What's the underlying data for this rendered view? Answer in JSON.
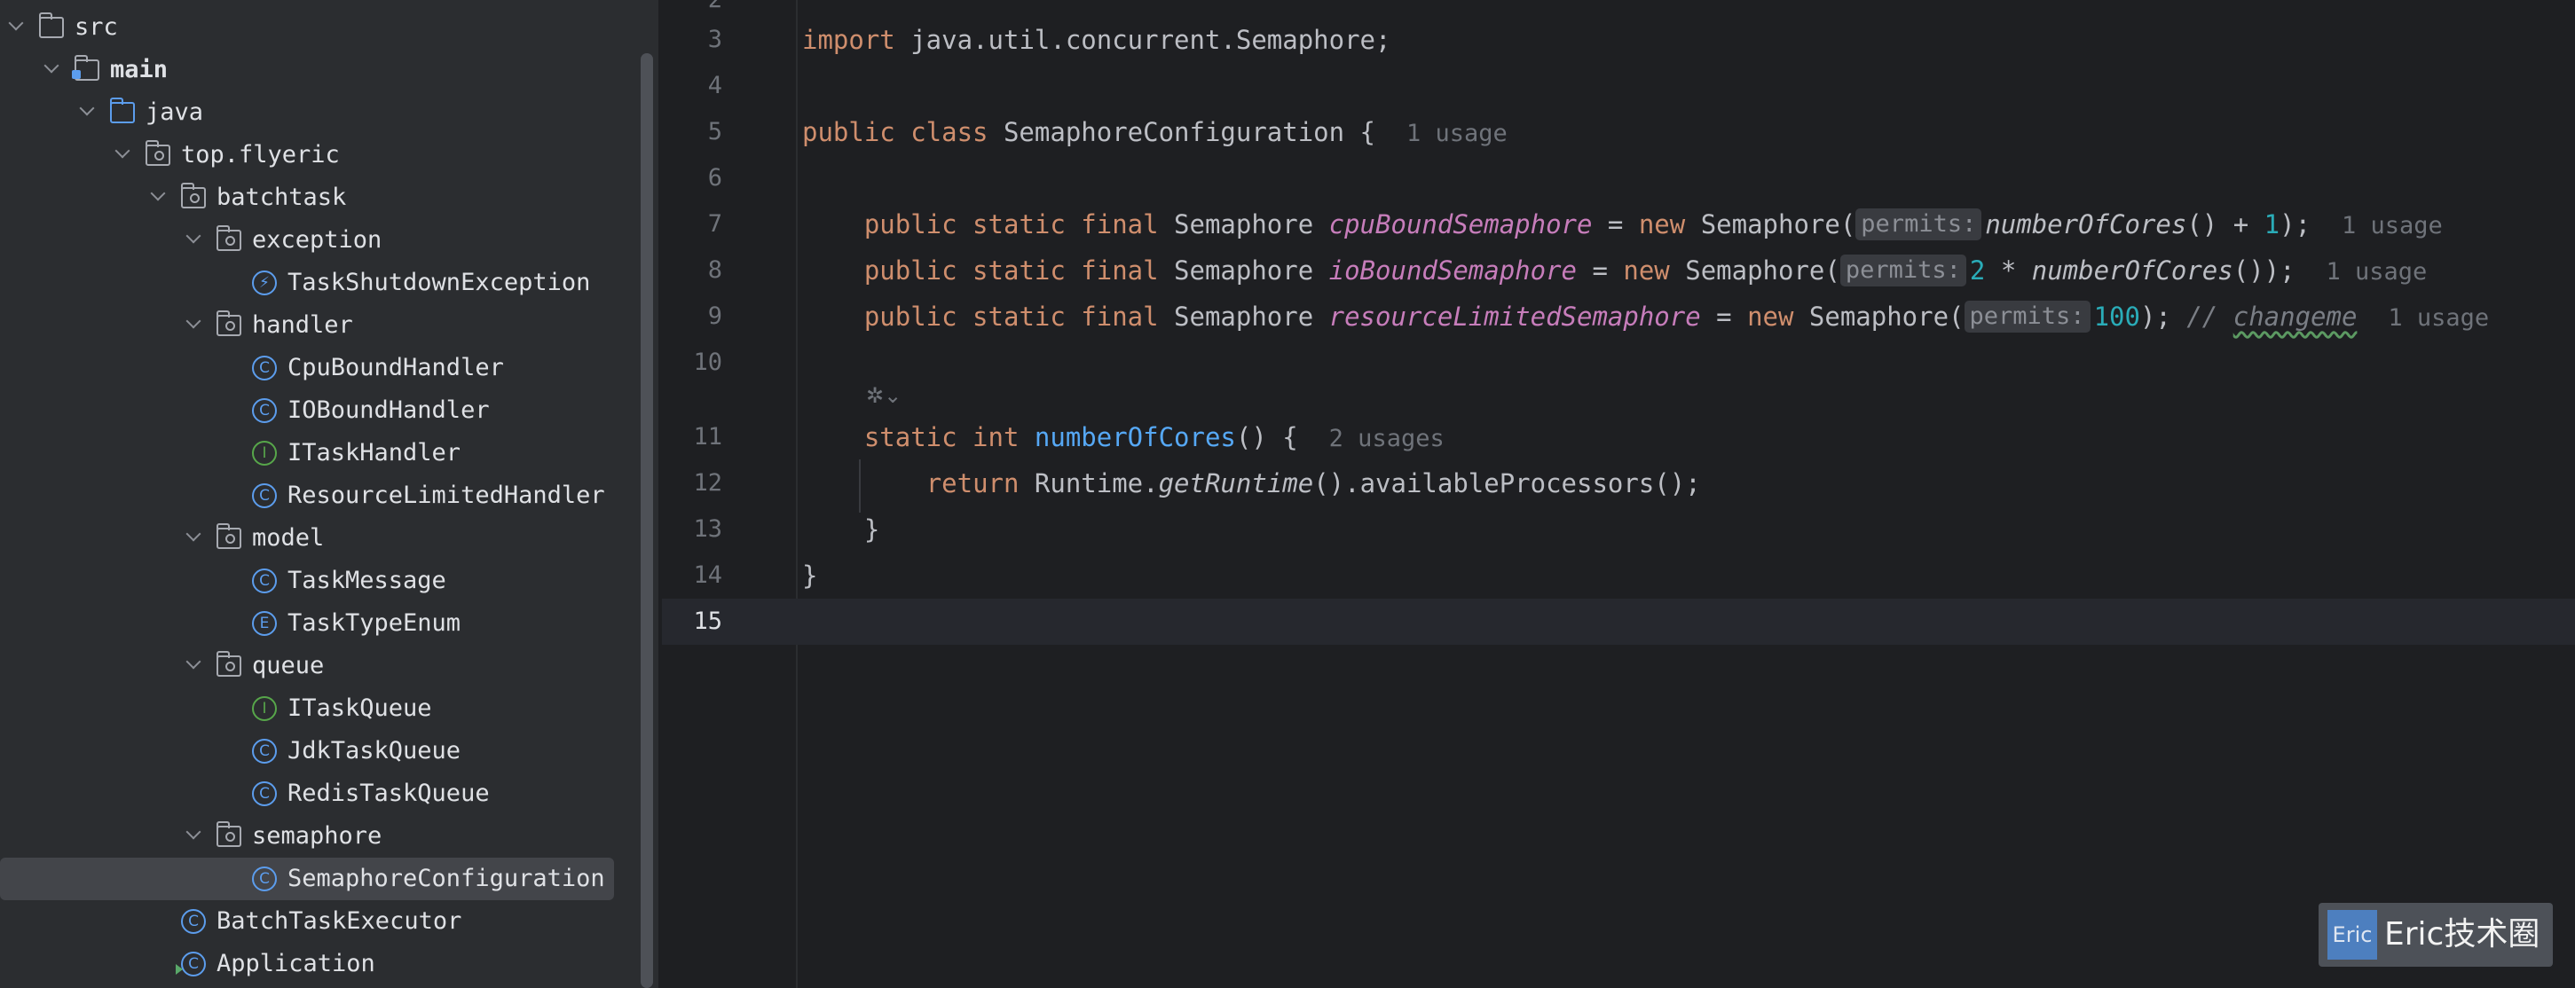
{
  "project_tree": {
    "items": [
      {
        "label": "src",
        "kind": "folder",
        "chevron": "expanded"
      },
      {
        "label": "main",
        "kind": "module-folder",
        "chevron": "expanded"
      },
      {
        "label": "java",
        "kind": "source-folder",
        "chevron": "expanded"
      },
      {
        "label": "top.flyeric",
        "kind": "package",
        "chevron": "expanded"
      },
      {
        "label": "batchtask",
        "kind": "package",
        "chevron": "expanded"
      },
      {
        "label": "exception",
        "kind": "package",
        "chevron": "expanded"
      },
      {
        "label": "TaskShutdownException",
        "kind": "exception-class"
      },
      {
        "label": "handler",
        "kind": "package",
        "chevron": "expanded"
      },
      {
        "label": "CpuBoundHandler",
        "kind": "class"
      },
      {
        "label": "IOBoundHandler",
        "kind": "class"
      },
      {
        "label": "ITaskHandler",
        "kind": "interface"
      },
      {
        "label": "ResourceLimitedHandler",
        "kind": "class"
      },
      {
        "label": "model",
        "kind": "package",
        "chevron": "expanded"
      },
      {
        "label": "TaskMessage",
        "kind": "class"
      },
      {
        "label": "TaskTypeEnum",
        "kind": "enum"
      },
      {
        "label": "queue",
        "kind": "package",
        "chevron": "expanded"
      },
      {
        "label": "ITaskQueue",
        "kind": "interface"
      },
      {
        "label": "JdkTaskQueue",
        "kind": "class"
      },
      {
        "label": "RedisTaskQueue",
        "kind": "class"
      },
      {
        "label": "semaphore",
        "kind": "package",
        "chevron": "expanded"
      },
      {
        "label": "SemaphoreConfiguration",
        "kind": "class",
        "selected": true
      },
      {
        "label": "BatchTaskExecutor",
        "kind": "class"
      },
      {
        "label": "Application",
        "kind": "spring-app-class"
      }
    ],
    "icon_glyphs": {
      "class": "C",
      "interface": "I",
      "enum": "E",
      "exception-class": "⚡"
    }
  },
  "editor": {
    "line_numbers": [
      "2",
      "3",
      "4",
      "5",
      "6",
      "7",
      "8",
      "9",
      "10",
      "11",
      "12",
      "13",
      "14",
      "15"
    ],
    "active_line": "15",
    "line3": {
      "kw": "import",
      "rest": " java.util.concurrent.Semaphore;"
    },
    "line5": {
      "kw": "public class",
      "name": " SemaphoreConfiguration {",
      "usage": "1 usage"
    },
    "line7": {
      "kw": "public static final",
      "type": " Semaphore ",
      "field": "cpuBoundSemaphore",
      "eq": " = ",
      "new": "new",
      "ctor": " Semaphore(",
      "hint": "permits:",
      "arg_call": "numberOfCores",
      "arg_rest": "() + ",
      "num": "1",
      "end": ");",
      "usage": "1 usage"
    },
    "line8": {
      "kw": "public static final",
      "type": " Semaphore ",
      "field": "ioBoundSemaphore",
      "eq": " = ",
      "new": "new",
      "ctor": " Semaphore(",
      "hint": "permits:",
      "num": "2",
      "mul": " * ",
      "arg_call": "numberOfCores",
      "end": "());",
      "usage": "1 usage"
    },
    "line9": {
      "kw": "public static final",
      "type": " Semaphore ",
      "field": "resourceLimitedSemaphore",
      "eq": " = ",
      "new": "new",
      "ctor": " Semaphore(",
      "hint": "permits:",
      "num": "100",
      "end": "); ",
      "comment": "// ",
      "comment_word": "changeme",
      "usage": "1 usage"
    },
    "line11": {
      "kw": "static int",
      "method": "numberOfCores",
      "rest": "() {",
      "usage": "2 usages"
    },
    "line12": {
      "kw": "return",
      "rest1": " Runtime.",
      "call": "getRuntime",
      "rest2": "().availableProcessors();"
    },
    "line13": {
      "text": "}"
    },
    "line14": {
      "text": "}"
    }
  },
  "watermark": {
    "logo_text": "Eric",
    "text": "Eric技术圈"
  },
  "colors": {
    "keyword": "#cf8e6d",
    "field": "#c77dbb",
    "number": "#2aacb8",
    "method": "#56a8f5",
    "background": "#1e1f22",
    "sidebar": "#2b2d30"
  }
}
